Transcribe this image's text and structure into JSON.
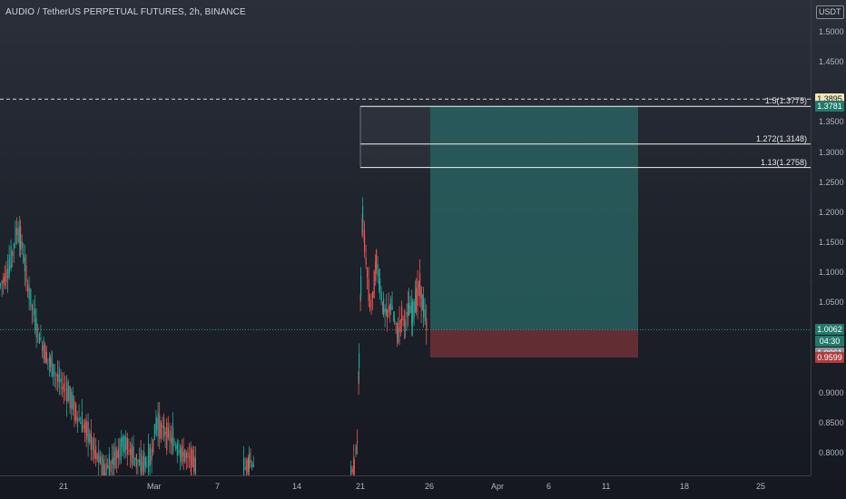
{
  "header": {
    "symbol_title": "AUDIO / TetherUS PERPETUAL FUTURES, 2h, BINANCE",
    "currency": "USDT"
  },
  "price_axis": {
    "ticks": [
      {
        "value": 1.5,
        "label": "1.5000"
      },
      {
        "value": 1.45,
        "label": "1.4500"
      },
      {
        "value": 1.35,
        "label": "1.3500"
      },
      {
        "value": 1.3,
        "label": "1.3000"
      },
      {
        "value": 1.25,
        "label": "1.2500"
      },
      {
        "value": 1.2,
        "label": "1.2000"
      },
      {
        "value": 1.15,
        "label": "1.1500"
      },
      {
        "value": 1.1,
        "label": "1.1000"
      },
      {
        "value": 1.05,
        "label": "1.0500"
      },
      {
        "value": 0.9,
        "label": "0.9000"
      },
      {
        "value": 0.85,
        "label": "0.8500"
      },
      {
        "value": 0.8,
        "label": "0.8000"
      }
    ],
    "tags": {
      "level_dashed": {
        "value": 1.3895,
        "label": "1.3895",
        "bg": "#f0e6b8",
        "color": "#1a1a1a"
      },
      "target": {
        "value": 1.3781,
        "label": "1.3781",
        "bg": "#22786b",
        "color": "#ffffff"
      },
      "current": {
        "value": 1.0062,
        "label": "1.0062",
        "bg": "#22786b",
        "color": "#ffffff"
      },
      "countdown": {
        "label": "04:30",
        "bg": "#22786b",
        "color": "#ffffff"
      },
      "entry": {
        "value": 1.0061,
        "label": "1.0061",
        "bg": "#8c8f97",
        "color": "#ffffff"
      },
      "stop": {
        "value": 0.9599,
        "label": "0.9599",
        "bg": "#b23b3e",
        "color": "#ffffff"
      }
    }
  },
  "time_axis": {
    "labels": [
      {
        "label": "21"
      },
      {
        "label": "Mar"
      },
      {
        "label": "7"
      },
      {
        "label": "14"
      },
      {
        "label": "21"
      },
      {
        "label": "26"
      },
      {
        "label": "Apr"
      },
      {
        "label": "6"
      },
      {
        "label": "11"
      },
      {
        "label": "18"
      },
      {
        "label": "25"
      }
    ]
  },
  "fib_levels": [
    {
      "label": "1.5(1.3775)",
      "value": 1.3775
    },
    {
      "label": "1.272(1.3148)",
      "value": 1.3148
    },
    {
      "label": "1.13(1.2758)",
      "value": 1.2758
    }
  ],
  "position": {
    "entry": 1.0061,
    "target": 1.3781,
    "stop": 0.9599,
    "profit_color": "#2a6b68",
    "loss_color": "#6b2f36"
  },
  "colors": {
    "up": "#26a69a",
    "down": "#ef5350",
    "fib_line": "#f2f2f2",
    "current_line": "#26a69a"
  },
  "chart_data": {
    "type": "candlestick",
    "symbol": "AUDIO / TetherUS PERPETUAL FUTURES",
    "interval": "2h",
    "exchange": "BINANCE",
    "ylim": [
      0.755,
      1.545
    ],
    "segments": [
      {
        "points": [
          [
            0,
            1.08
          ],
          [
            10,
            1.11
          ],
          [
            18,
            1.17
          ],
          [
            22,
            1.16
          ],
          [
            30,
            1.08
          ],
          [
            38,
            1.02
          ],
          [
            46,
            0.98
          ],
          [
            55,
            0.95
          ],
          [
            65,
            0.92
          ],
          [
            75,
            0.9
          ],
          [
            85,
            0.86
          ],
          [
            95,
            0.84
          ],
          [
            105,
            0.8
          ],
          [
            115,
            0.77
          ],
          [
            125,
            0.79
          ],
          [
            135,
            0.82
          ],
          [
            145,
            0.8
          ],
          [
            155,
            0.78
          ],
          [
            165,
            0.79
          ],
          [
            172,
            0.85
          ],
          [
            180,
            0.84
          ],
          [
            190,
            0.82
          ],
          [
            200,
            0.8
          ],
          [
            210,
            0.79
          ],
          [
            216,
            0.78
          ]
        ]
      },
      {
        "points": [
          [
            268,
            0.77
          ],
          [
            274,
            0.79
          ],
          [
            280,
            0.78
          ]
        ]
      },
      {
        "points": [
          [
            386,
            0.76
          ],
          [
            390,
            0.78
          ],
          [
            393,
            0.82
          ],
          [
            395,
            0.95
          ],
          [
            397,
            1.08
          ],
          [
            399,
            1.2
          ],
          [
            401,
            1.15
          ],
          [
            404,
            1.1
          ],
          [
            407,
            1.05
          ],
          [
            410,
            1.06
          ],
          [
            414,
            1.12
          ],
          [
            418,
            1.08
          ],
          [
            422,
            1.04
          ],
          [
            426,
            1.03
          ],
          [
            430,
            1.05
          ],
          [
            434,
            1.02
          ],
          [
            438,
            1.0
          ],
          [
            442,
            1.03
          ],
          [
            446,
            1.02
          ],
          [
            450,
            1.04
          ],
          [
            454,
            1.03
          ],
          [
            458,
            1.06
          ],
          [
            462,
            1.08
          ],
          [
            466,
            1.04
          ],
          [
            470,
            1.0062
          ]
        ]
      }
    ]
  }
}
